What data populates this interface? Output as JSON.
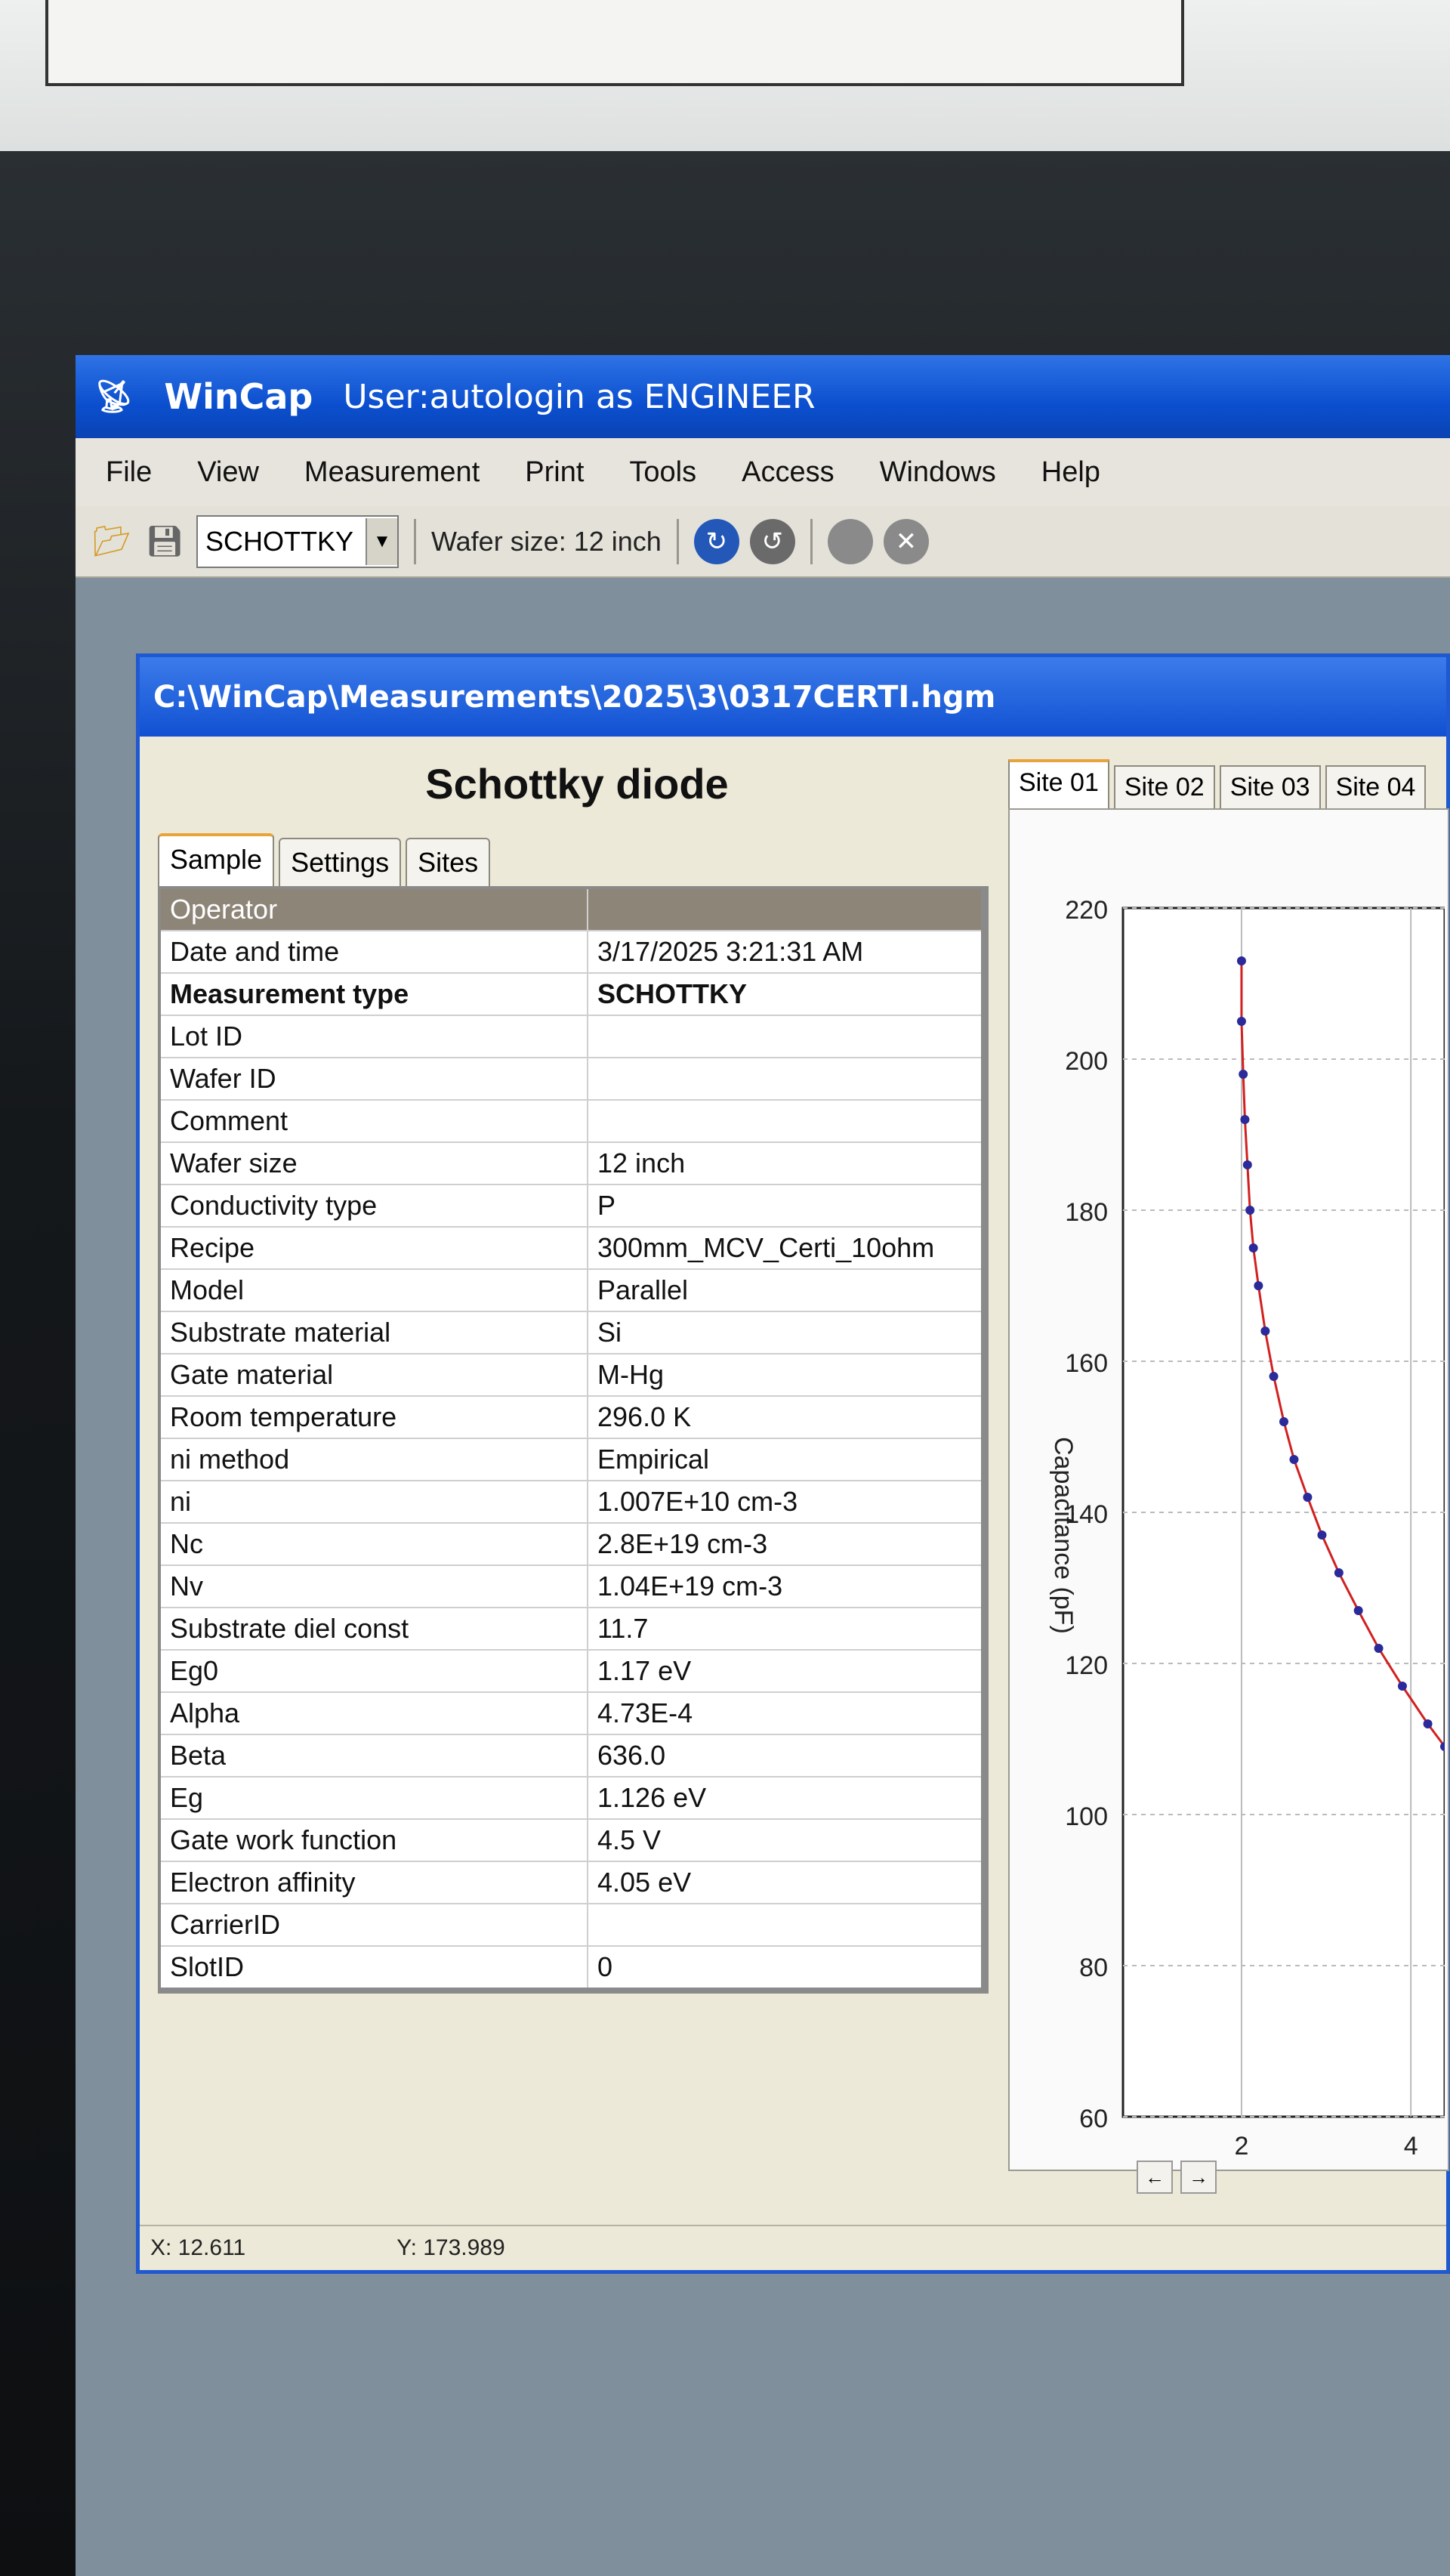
{
  "app": {
    "name": "WinCap",
    "user": "User:autologin  as ENGINEER"
  },
  "menu": [
    "File",
    "View",
    "Measurement",
    "Print",
    "Tools",
    "Access",
    "Windows",
    "Help"
  ],
  "toolbar": {
    "measurement_select": "SCHOTTKY",
    "wafer_size_label": "Wafer size: 12 inch"
  },
  "document": {
    "path": "C:\\WinCap\\Measurements\\2025\\3\\0317CERTI.hgm",
    "heading": "Schottky diode",
    "tabs": [
      "Sample",
      "Settings",
      "Sites"
    ],
    "properties": [
      {
        "key": "Operator",
        "value": ""
      },
      {
        "key": "Date and time",
        "value": "3/17/2025 3:21:31 AM"
      },
      {
        "key": "Measurement type",
        "value": "SCHOTTKY"
      },
      {
        "key": "Lot ID",
        "value": ""
      },
      {
        "key": "Wafer ID",
        "value": ""
      },
      {
        "key": "Comment",
        "value": ""
      },
      {
        "key": "Wafer size",
        "value": "12 inch"
      },
      {
        "key": "Conductivity type",
        "value": "P"
      },
      {
        "key": "Recipe",
        "value": "300mm_MCV_Certi_10ohm"
      },
      {
        "key": "Model",
        "value": "Parallel"
      },
      {
        "key": "Substrate material",
        "value": "Si"
      },
      {
        "key": "Gate material",
        "value": "M-Hg"
      },
      {
        "key": "Room temperature",
        "value": "296.0 K"
      },
      {
        "key": "ni method",
        "value": "Empirical"
      },
      {
        "key": "ni",
        "value": "1.007E+10 cm-3"
      },
      {
        "key": "Nc",
        "value": "2.8E+19 cm-3"
      },
      {
        "key": "Nv",
        "value": "1.04E+19 cm-3"
      },
      {
        "key": "Substrate diel const",
        "value": "11.7"
      },
      {
        "key": "Eg0",
        "value": "1.17 eV"
      },
      {
        "key": "Alpha",
        "value": "4.73E-4"
      },
      {
        "key": "Beta",
        "value": "636.0"
      },
      {
        "key": "Eg",
        "value": "1.126 eV"
      },
      {
        "key": "Gate work function",
        "value": "4.5 V"
      },
      {
        "key": "Electron affinity",
        "value": "4.05 eV"
      },
      {
        "key": "CarrierID",
        "value": ""
      },
      {
        "key": "SlotID",
        "value": "0"
      }
    ]
  },
  "sites": [
    "Site 01",
    "Site 02",
    "Site 03",
    "Site 04"
  ],
  "status": {
    "x": "X: 12.611",
    "y": "Y: 173.989"
  },
  "colors": {
    "title_blue": "#0b4fcf",
    "series_fit": "#d22020",
    "series_points": "#2a2a9a"
  },
  "chart_data": {
    "type": "line",
    "ylabel": "Capacitance (pF)",
    "xlabel": "",
    "ylim": [
      60,
      220
    ],
    "xlim": [
      0.6,
      4.4
    ],
    "yticks": [
      220,
      200,
      180,
      160,
      140,
      120,
      100,
      80,
      60
    ],
    "xticks": [
      2,
      4
    ],
    "series": [
      {
        "x": [
          2.0,
          2.0,
          2.02,
          2.04,
          2.07,
          2.1,
          2.14,
          2.2,
          2.28,
          2.38,
          2.5,
          2.62,
          2.78,
          2.95,
          3.15,
          3.38,
          3.62,
          3.9,
          4.2,
          4.4
        ],
        "y": [
          213,
          205,
          198,
          192,
          186,
          180,
          175,
          170,
          164,
          158,
          152,
          147,
          142,
          137,
          132,
          127,
          122,
          117,
          112,
          109
        ]
      }
    ]
  }
}
